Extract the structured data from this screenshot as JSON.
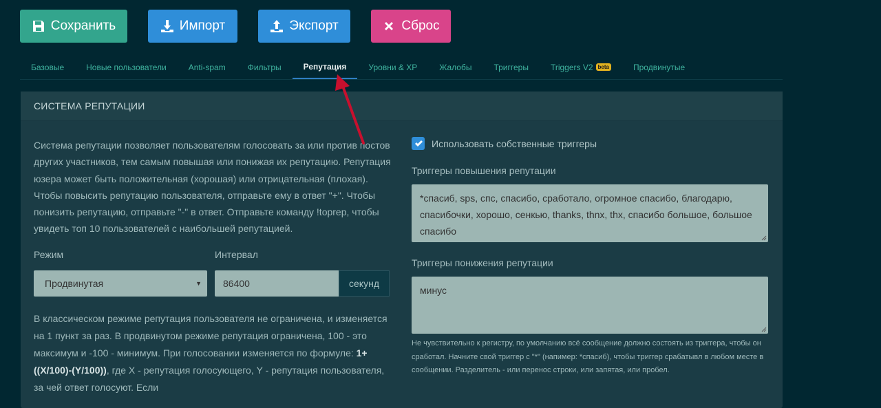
{
  "toolbar": {
    "save_label": "Сохранить",
    "import_label": "Импорт",
    "export_label": "Экспорт",
    "reset_label": "Сброс"
  },
  "tabs": [
    {
      "label": "Базовые"
    },
    {
      "label": "Новые пользователи"
    },
    {
      "label": "Anti-spam"
    },
    {
      "label": "Фильтры"
    },
    {
      "label": "Репутация"
    },
    {
      "label": "Уровни & XP"
    },
    {
      "label": "Жалобы"
    },
    {
      "label": "Триггеры"
    },
    {
      "label": "Triggers V2",
      "badge": "beta"
    },
    {
      "label": "Продвинутые"
    }
  ],
  "active_tab": "Репутация",
  "panel": {
    "title": "СИСТЕМА РЕПУТАЦИИ",
    "description": "Система репутации позволяет пользователям голосовать за или против постов других участников, тем самым повышая или понижая их репутацию. Репутация юзера может быть положительная (хорошая) или отрицательная (плохая). Чтобы повысить репутацию пользователя, отправьте ему в ответ \"+\". Чтобы понизить репутацию, отправьте \"-\" в ответ. Отправьте команду !toprep, чтобы увидеть топ 10 пользователей с наибольшей репутацией.",
    "mode_label": "Режим",
    "mode_value": "Продвинутая",
    "interval_label": "Интервал",
    "interval_value": "86400",
    "interval_unit": "секунд",
    "mode_help_1": "В классическом режиме репутация пользователя не ограничена, и изменяется на 1 пункт за раз. В продвинутом режиме репутация ограничена, 100 - это максимум и -100 - минимум. При голосовании изменяется по формуле:",
    "formula": "1+((X/100)-(Y/100))",
    "mode_help_2": ", где X - репутация голосующего, Y - репутация пользователя, за чей ответ голосуют. Если",
    "custom_triggers_label": "Использовать собственные триггеры",
    "custom_triggers_checked": true,
    "up_label": "Триггеры повышения репутации",
    "up_value": "*спасиб, sps, спс, спасибо, сработало, огромное спасибо, благодарю, спасибочки, хорошо, сенкью, thanks, thnx, thx, спасибо большое, большое спасибо",
    "down_label": "Триггеры понижения репутации",
    "down_value": "минус",
    "trigger_help": "Не чувствительно к регистру, по умолчанию всё сообщение должно состоять из триггера, чтобы он сработал. Начните свой триггер с \"*\" (напимер: *спасиб), чтобы триггер срабатывл в любом месте в сообщении. Разделитель - или перенос строки, или запятая, или пробел."
  },
  "colors": {
    "background": "#012731",
    "save": "#33a58d",
    "import_export": "#2f8ed9",
    "reset": "#d9448a",
    "tab_text": "#3fb39f",
    "panel": "#1b3c45",
    "input": "#9db6b3",
    "annotation_arrow": "#c8102e"
  }
}
